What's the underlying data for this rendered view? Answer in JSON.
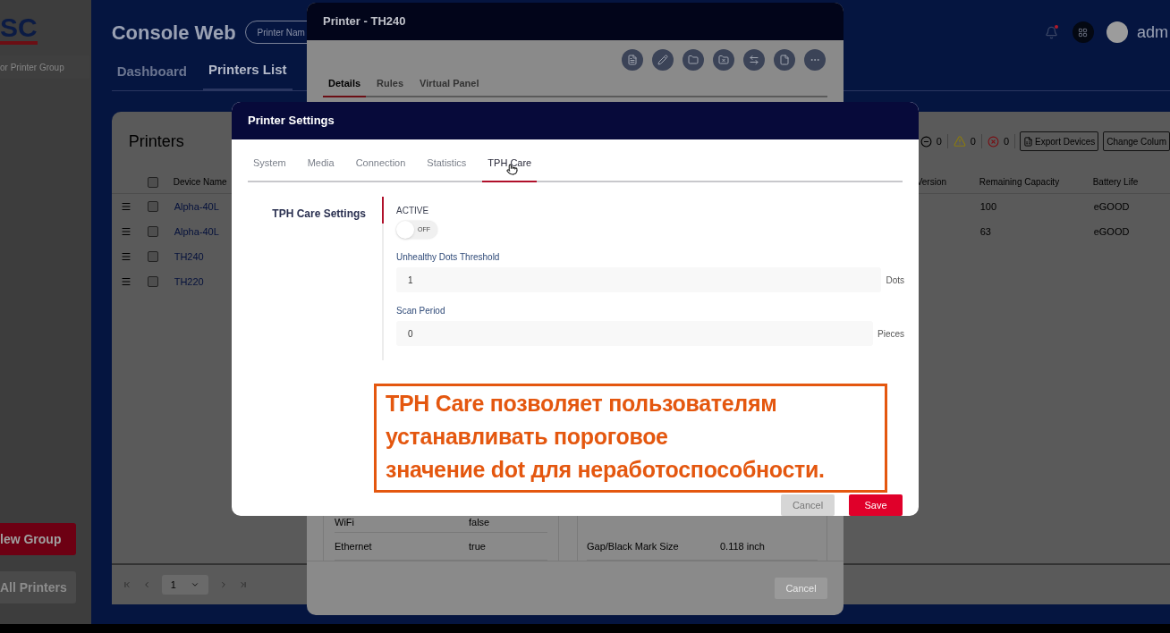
{
  "sidebar": {
    "logo_text": "SC",
    "group_search": {
      "placeholder": "or Printer Group"
    },
    "buttons": [
      {
        "label": "lew Group",
        "kind": "primary"
      },
      {
        "label": "All Printers",
        "kind": "secondary"
      }
    ]
  },
  "header": {
    "title": "Console Web",
    "search": {
      "placeholder": "Printer Nam"
    },
    "user": "adm",
    "notification": true
  },
  "nav_tabs": [
    {
      "label": "Dashboard",
      "selected": false
    },
    {
      "label": "Printers List",
      "selected": true
    }
  ],
  "printers": {
    "title": "Printers",
    "status_counts": [
      {
        "kind": "offline",
        "count": "0"
      },
      {
        "kind": "warning",
        "count": "0"
      },
      {
        "kind": "error",
        "count": "0"
      }
    ],
    "actions": [
      "Export Devices",
      "Change Colum"
    ],
    "select_all_checked": false,
    "columns": [
      "Device Name",
      "Version",
      "Remaining Capacity",
      "Battery Life"
    ],
    "rows": [
      {
        "checked": false,
        "device_name": "Alpha-40L",
        "remaining_capacity": "100",
        "battery_life": "eGOOD"
      },
      {
        "checked": false,
        "device_name": "Alpha-40L",
        "remaining_capacity": "63",
        "battery_life": "eGOOD"
      },
      {
        "checked": false,
        "device_name": "TH240"
      },
      {
        "checked": false,
        "device_name": "TH220"
      }
    ],
    "page": "1"
  },
  "printer_dialog": {
    "title": "Printer - TH240",
    "tabs": [
      {
        "label": "Details",
        "selected": true
      },
      {
        "label": "Rules",
        "selected": false
      },
      {
        "label": "Virtual Panel",
        "selected": false
      }
    ],
    "left_rows": [
      {
        "label": "WiFi",
        "value": "false"
      },
      {
        "label": "Ethernet",
        "value": "true"
      }
    ],
    "right_rows": [
      {
        "label": "Gap/Black Mark Size",
        "value": "0.118 inch"
      }
    ],
    "cancel": "Cancel"
  },
  "settings_dialog": {
    "title": "Printer Settings",
    "tabs": [
      {
        "label": "System",
        "selected": false
      },
      {
        "label": "Media",
        "selected": false
      },
      {
        "label": "Connection",
        "selected": false
      },
      {
        "label": "Statistics",
        "selected": false
      },
      {
        "label": "TPH Care",
        "selected": true
      }
    ],
    "section": "TPH Care Settings",
    "active": {
      "label": "ACTIVE",
      "on": false,
      "state_text": "OFF"
    },
    "fields": [
      {
        "label": "Unhealthy Dots Threshold",
        "value": "1",
        "unit": "Dots"
      },
      {
        "label": "Scan Period",
        "value": "0",
        "unit": "Pieces"
      }
    ],
    "cancel": {
      "label": "Cancel",
      "disabled": true
    },
    "save": "Save"
  },
  "annotation": "TPH Care позволяет пользователям\nустанавливать пороговое\nзначение dot для неработоспособности."
}
